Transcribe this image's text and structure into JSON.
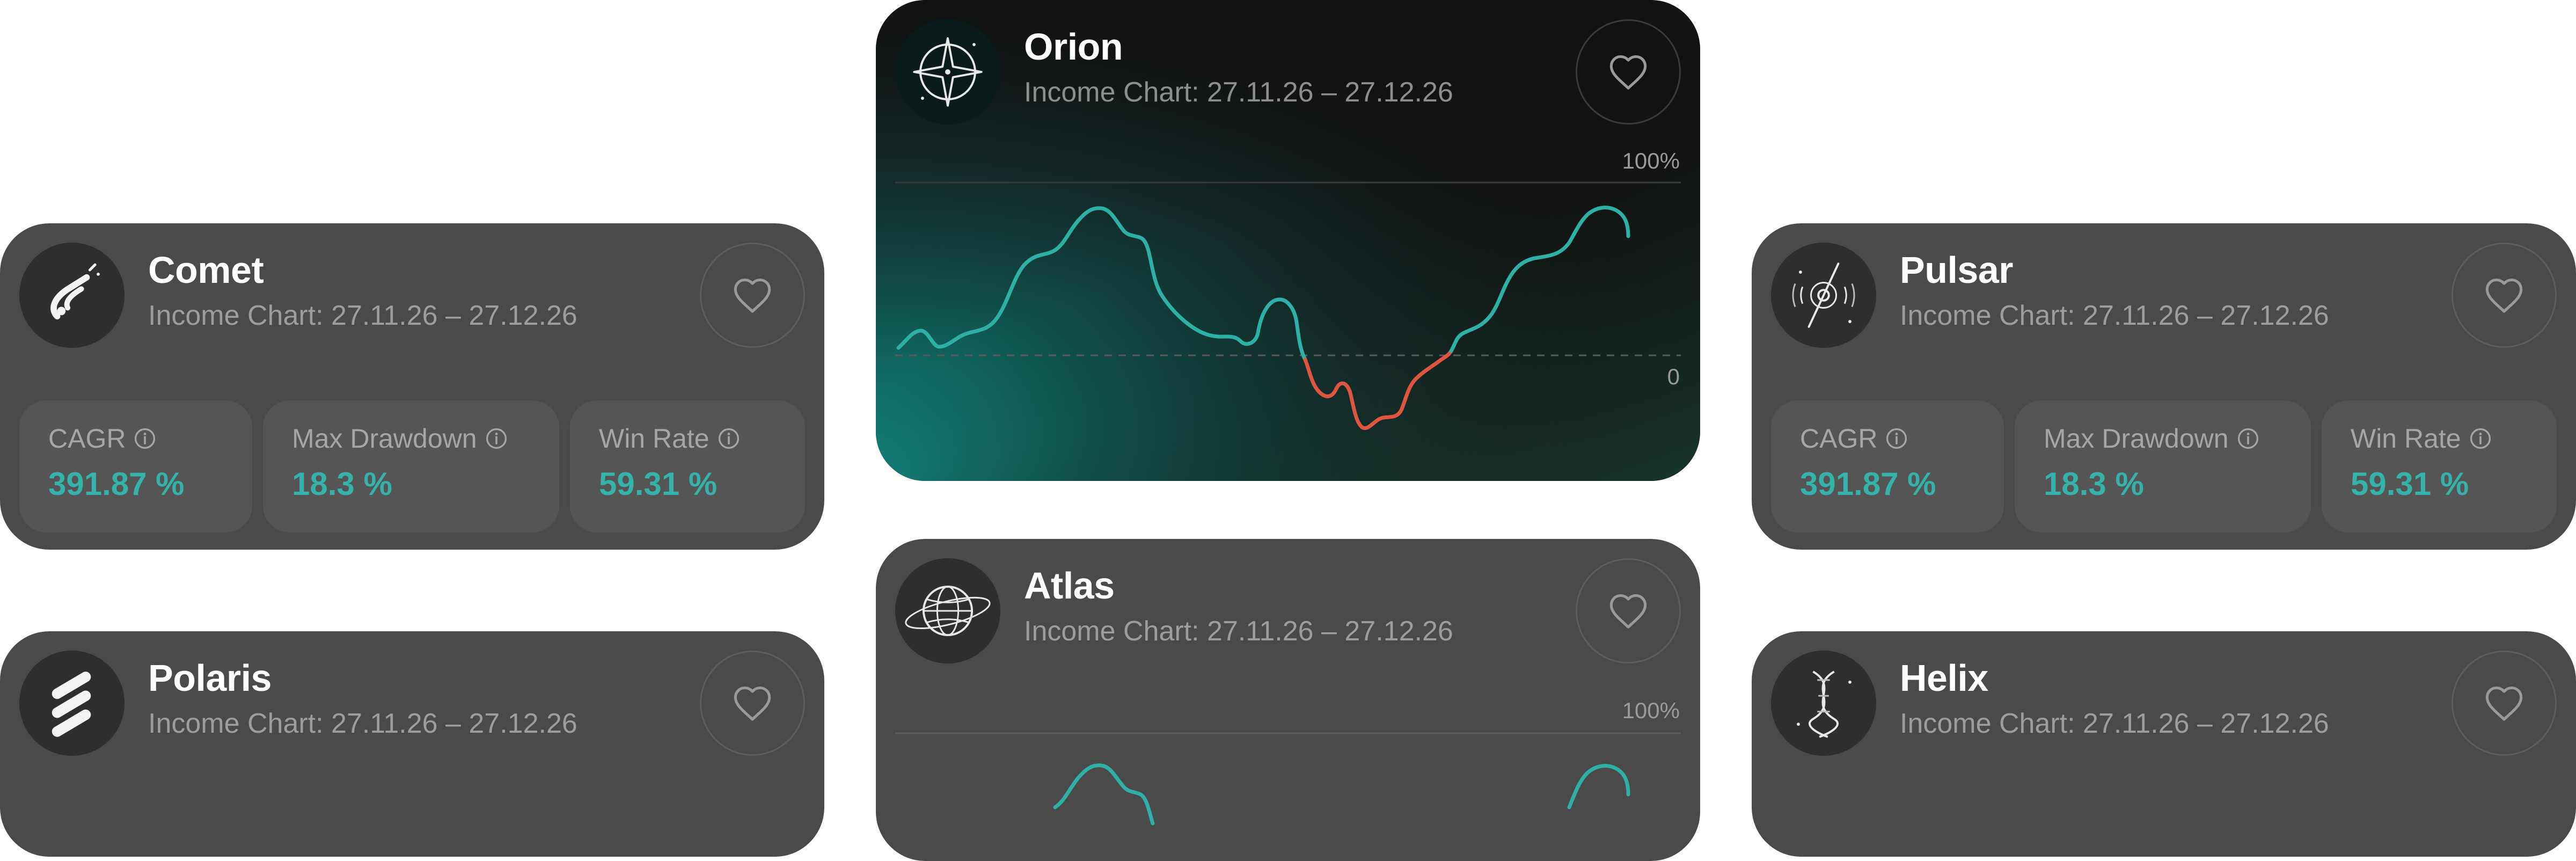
{
  "colors": {
    "accent": "#35b2a9",
    "loss": "#e0553f",
    "card_grey": "#4a4a4a",
    "card_dark": "#121212"
  },
  "cards": {
    "comet": {
      "name": "Comet",
      "subtitle": "Income Chart: 27.11.26 – 27.12.26",
      "icon": "comet-icon",
      "stats": [
        {
          "label": "CAGR",
          "value": "391.87 %"
        },
        {
          "label": "Max Drawdown",
          "value": "18.3 %"
        },
        {
          "label": "Win Rate",
          "value": "59.31 %"
        }
      ]
    },
    "orion": {
      "name": "Orion",
      "subtitle": "Income Chart: 27.11.26 – 27.12.26",
      "icon": "compass-star-icon",
      "chart": {
        "top_label": "100%",
        "zero_label": "0"
      }
    },
    "pulsar": {
      "name": "Pulsar",
      "subtitle": "Income Chart: 27.11.26 – 27.12.26",
      "icon": "pulsar-icon",
      "stats": [
        {
          "label": "CAGR",
          "value": "391.87 %"
        },
        {
          "label": "Max Drawdown",
          "value": "18.3 %"
        },
        {
          "label": "Win Rate",
          "value": "59.31 %"
        }
      ]
    },
    "polaris": {
      "name": "Polaris",
      "subtitle": "Income Chart: 27.11.26 – 27.12.26",
      "icon": "polaris-stripes-icon"
    },
    "atlas": {
      "name": "Atlas",
      "subtitle": "Income Chart: 27.11.26 – 27.12.26",
      "icon": "globe-icon",
      "chart": {
        "top_label": "100%"
      }
    },
    "helix": {
      "name": "Helix",
      "subtitle": "Income Chart: 27.11.26 – 27.12.26",
      "icon": "dna-helix-icon"
    }
  }
}
